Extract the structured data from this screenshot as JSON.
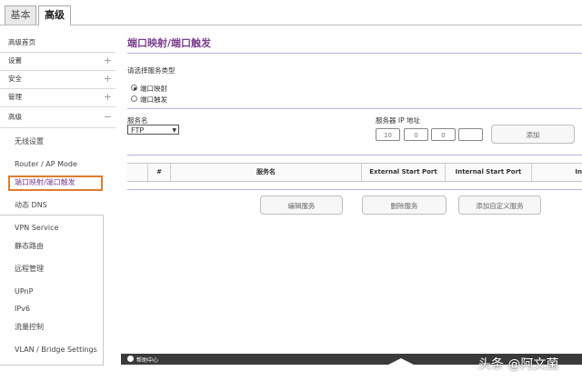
{
  "tabs": [
    {
      "label": "基本",
      "active": false
    },
    {
      "label": "高级",
      "active": true
    }
  ],
  "sidebar": {
    "groups": [
      {
        "label": "高级首页",
        "sign": ""
      },
      {
        "label": "设置",
        "sign": "+"
      },
      {
        "label": "安全",
        "sign": "+"
      },
      {
        "label": "管理",
        "sign": "+"
      },
      {
        "label": "高级",
        "sign": "−"
      }
    ],
    "sub_items": [
      "无线设置",
      "Router / AP Mode",
      "端口映射/端口触发",
      "动态 DNS",
      "VPN Service",
      "静态路由",
      "远程管理",
      "UPnP",
      "IPv6",
      "流量控制",
      "VLAN / Bridge Settings"
    ]
  },
  "main": {
    "title": "端口映射/端口触发",
    "service_type_label": "请选择服务类型",
    "radio_options": [
      {
        "label": "端口映射",
        "selected": true
      },
      {
        "label": "端口触发",
        "selected": false
      }
    ],
    "service_name_label": "服务名",
    "service_name_value": "FTP",
    "server_ip_label": "服务器 IP 地址",
    "ip_fields": [
      "10",
      "0",
      "0",
      ""
    ],
    "add_button": "添加",
    "table_headers": [
      "#",
      "服务名",
      "External Start Port",
      "Internal Start Port",
      "In"
    ],
    "buttons": {
      "edit": "编辑服务",
      "delete": "删除服务",
      "add_custom": "添加自定义服务"
    }
  },
  "footer": {
    "help_label": "帮助中心",
    "watermark": "头条 @阿文菌"
  },
  "colors": {
    "title": "#7b3f8f",
    "highlight_border": "#e07d2c",
    "bottom_bar": "#3a3a3a"
  }
}
